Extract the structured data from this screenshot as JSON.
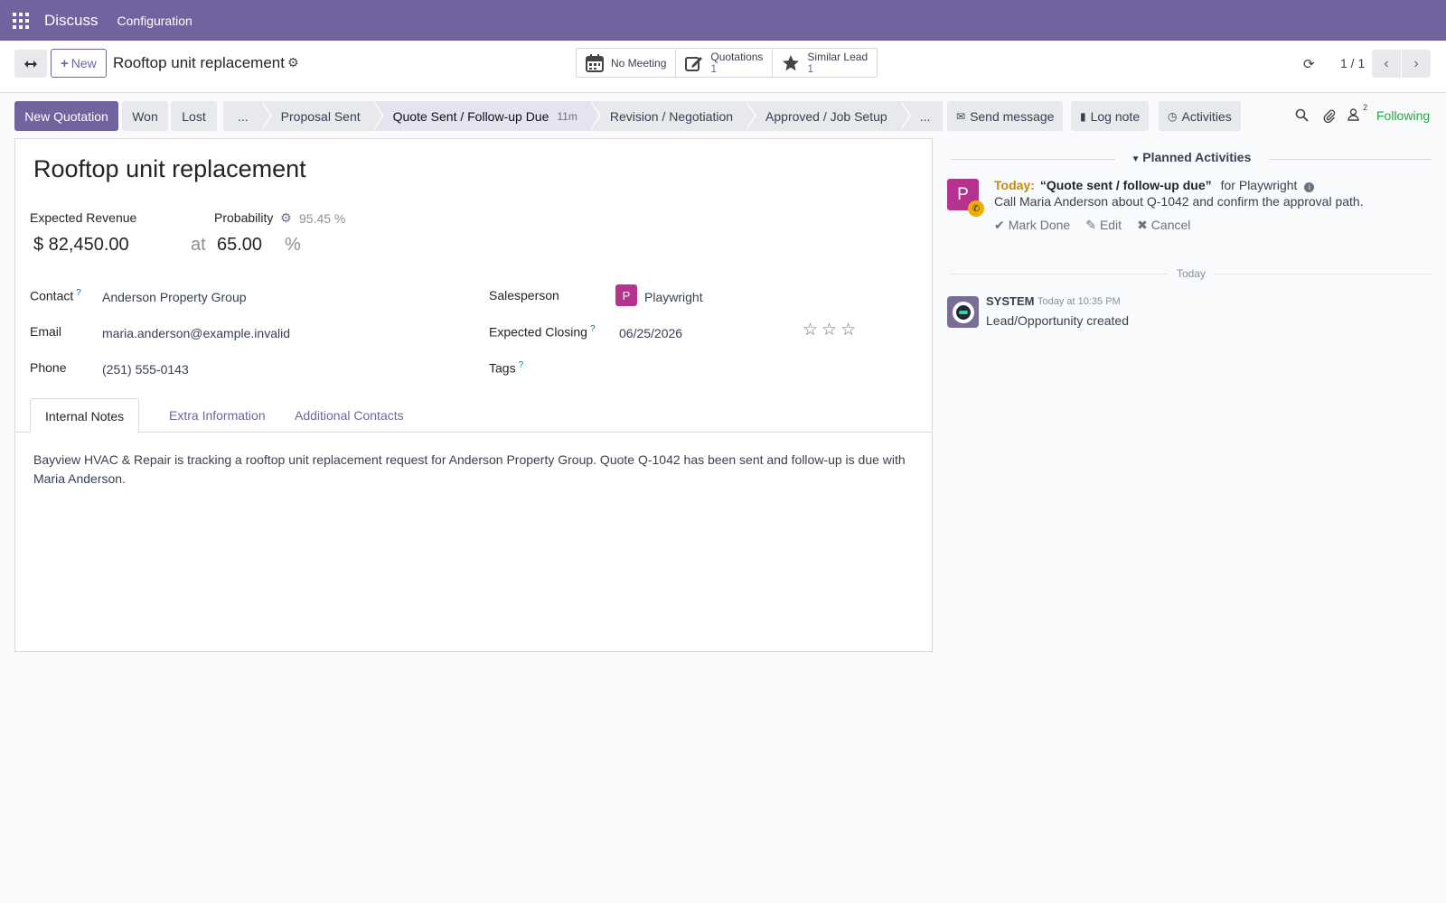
{
  "topnav": {
    "app_name": "Discuss",
    "menu": [
      "Configuration"
    ]
  },
  "control_panel": {
    "new_label": "New",
    "record_title": "Rooftop unit replacement",
    "smart_buttons": [
      {
        "label": "No Meeting",
        "icon": "calendar-icon"
      },
      {
        "label": "Quotations",
        "count": "1",
        "icon": "edit-icon"
      },
      {
        "label": "Similar Lead",
        "count": "1",
        "icon": "star-icon"
      }
    ],
    "pager": "1 / 1"
  },
  "statusbar": {
    "buttons": [
      "New Quotation",
      "Won",
      "Lost"
    ],
    "stages": [
      {
        "label": "...",
        "active": false
      },
      {
        "label": "Proposal Sent",
        "active": false
      },
      {
        "label": "Quote Sent / Follow-up Due",
        "duration": "11m",
        "active": true
      },
      {
        "label": "Revision / Negotiation",
        "active": false
      },
      {
        "label": "Approved / Job Setup",
        "active": false
      },
      {
        "label": "...",
        "active": false
      }
    ]
  },
  "form": {
    "title": "Rooftop unit replacement",
    "expected_revenue_label": "Expected Revenue",
    "expected_revenue": "$ 82,450.00",
    "at": "at",
    "probability_label": "Probability",
    "probability_auto": "95.45 %",
    "probability": "65.00",
    "pct": "%",
    "contact_label": "Contact",
    "contact": "Anderson Property Group",
    "email_label": "Email",
    "email": "maria.anderson@example.invalid",
    "phone_label": "Phone",
    "phone": "(251) 555-0143",
    "salesperson_label": "Salesperson",
    "salesperson_initial": "P",
    "salesperson": "Playwright",
    "expected_closing_label": "Expected Closing",
    "expected_closing": "06/25/2026",
    "tags_label": "Tags",
    "help_mark": "?",
    "priority_stars": 0,
    "tabs": [
      "Internal Notes",
      "Extra Information",
      "Additional Contacts"
    ],
    "notes": "Bayview HVAC & Repair is tracking a rooftop unit replacement request for Anderson Property Group. Quote Q-1042 has been sent and follow-up is due with Maria Anderson."
  },
  "chatter": {
    "send_message": "Send message",
    "log_note": "Log note",
    "activities": "Activities",
    "followers_count": "2",
    "following": "Following",
    "planned_activities": "Planned Activities",
    "activity": {
      "avatar_initial": "P",
      "when": "Today:",
      "summary": "“Quote sent / follow-up due”",
      "for": "for Playwright",
      "note": "Call Maria Anderson about Q-1042 and confirm the approval path.",
      "mark_done": "Mark Done",
      "edit": "Edit",
      "cancel": "Cancel"
    },
    "date_separator": "Today",
    "message": {
      "author": "SYSTEM",
      "time": "Today at 10:35 PM",
      "body": "Lead/Opportunity created"
    }
  },
  "colors": {
    "brand": "#71639e",
    "following": "#28a745",
    "activity_today": "#c98a00",
    "avatar": "#b5338e"
  }
}
